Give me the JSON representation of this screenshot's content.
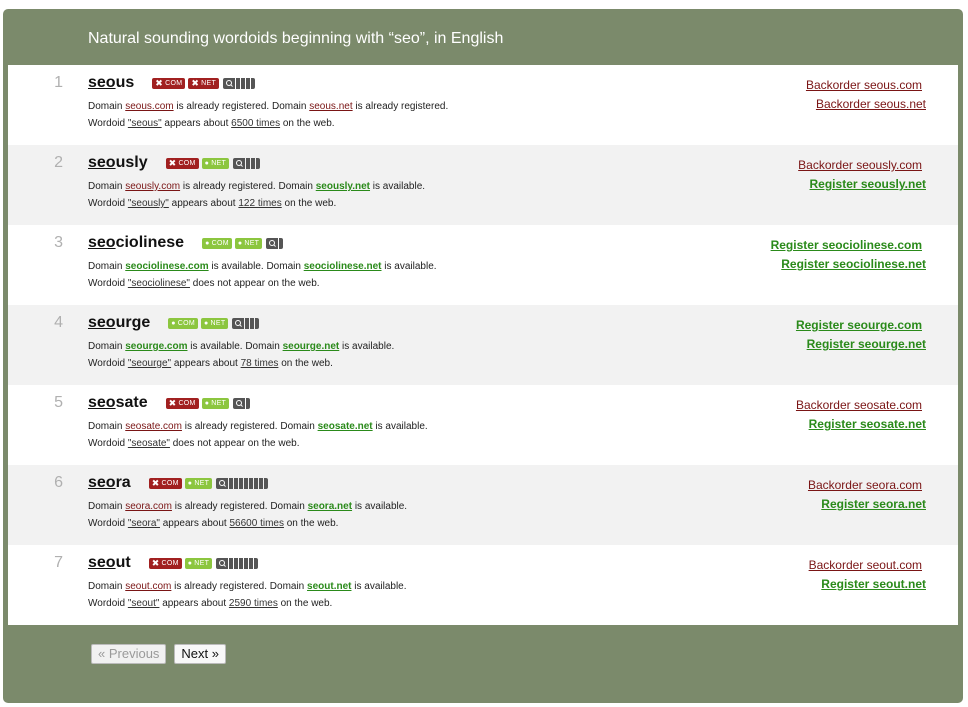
{
  "header": {
    "title": "Natural sounding wordoids beginning with “seo”, in English"
  },
  "results": [
    {
      "rank": "1",
      "prefix": "seo",
      "rest": "us",
      "com": {
        "status": "taken",
        "label": "COM",
        "domain": "seous.com",
        "text": "is already registered."
      },
      "net": {
        "status": "taken",
        "label": "NET",
        "domain": "seous.net",
        "text": "is already registered."
      },
      "meter_bars": 4,
      "freq_prefix": "Wordoid",
      "freq_word": "\"seous\"",
      "freq_before": "appears about",
      "freq_count": "6500 times",
      "freq_after": "on the web.",
      "action_com": "Backorder seous.com",
      "action_net": "Backorder seous.net"
    },
    {
      "rank": "2",
      "prefix": "seo",
      "rest": "usly",
      "com": {
        "status": "taken",
        "label": "COM",
        "domain": "seously.com",
        "text": "is already registered."
      },
      "net": {
        "status": "free",
        "label": "NET",
        "domain": "seously.net",
        "text": "is available."
      },
      "meter_bars": 3,
      "freq_prefix": "Wordoid",
      "freq_word": "\"seously\"",
      "freq_before": "appears about",
      "freq_count": "122 times",
      "freq_after": "on the web.",
      "action_com": "Backorder seously.com",
      "action_net": "Register seously.net"
    },
    {
      "rank": "3",
      "prefix": "seo",
      "rest": "ciolinese",
      "com": {
        "status": "free",
        "label": "COM",
        "domain": "seociolinese.com",
        "text": "is available."
      },
      "net": {
        "status": "free",
        "label": "NET",
        "domain": "seociolinese.net",
        "text": "is available."
      },
      "meter_bars": 1,
      "freq_prefix": "Wordoid",
      "freq_word": "\"seociolinese\"",
      "freq_before": "does not appear on the web.",
      "freq_count": "",
      "freq_after": "",
      "action_com": "Register seociolinese.com",
      "action_net": "Register seociolinese.net"
    },
    {
      "rank": "4",
      "prefix": "seo",
      "rest": "urge",
      "com": {
        "status": "free",
        "label": "COM",
        "domain": "seourge.com",
        "text": "is available."
      },
      "net": {
        "status": "free",
        "label": "NET",
        "domain": "seourge.net",
        "text": "is available."
      },
      "meter_bars": 3,
      "freq_prefix": "Wordoid",
      "freq_word": "\"seourge\"",
      "freq_before": "appears about",
      "freq_count": "78 times",
      "freq_after": "on the web.",
      "action_com": "Register seourge.com",
      "action_net": "Register seourge.net"
    },
    {
      "rank": "5",
      "prefix": "seo",
      "rest": "sate",
      "com": {
        "status": "taken",
        "label": "COM",
        "domain": "seosate.com",
        "text": "is already registered."
      },
      "net": {
        "status": "free",
        "label": "NET",
        "domain": "seosate.net",
        "text": "is available."
      },
      "meter_bars": 1,
      "freq_prefix": "Wordoid",
      "freq_word": "\"seosate\"",
      "freq_before": "does not appear on the web.",
      "freq_count": "",
      "freq_after": "",
      "action_com": "Backorder seosate.com",
      "action_net": "Register seosate.net"
    },
    {
      "rank": "6",
      "prefix": "seo",
      "rest": "ra",
      "com": {
        "status": "taken",
        "label": "COM",
        "domain": "seora.com",
        "text": "is already registered."
      },
      "net": {
        "status": "free",
        "label": "NET",
        "domain": "seora.net",
        "text": "is available."
      },
      "meter_bars": 8,
      "freq_prefix": "Wordoid",
      "freq_word": "\"seora\"",
      "freq_before": "appears about",
      "freq_count": "56600 times",
      "freq_after": "on the web.",
      "action_com": "Backorder seora.com",
      "action_net": "Register seora.net"
    },
    {
      "rank": "7",
      "prefix": "seo",
      "rest": "ut",
      "com": {
        "status": "taken",
        "label": "COM",
        "domain": "seout.com",
        "text": "is already registered."
      },
      "net": {
        "status": "free",
        "label": "NET",
        "domain": "seout.net",
        "text": "is available."
      },
      "meter_bars": 6,
      "freq_prefix": "Wordoid",
      "freq_word": "\"seout\"",
      "freq_before": "appears about",
      "freq_count": "2590 times",
      "freq_after": "on the web.",
      "action_com": "Backorder seout.com",
      "action_net": "Register seout.net"
    }
  ],
  "labels": {
    "domain_word": "Domain",
    "taken_mark": "✖",
    "free_mark": "●"
  },
  "pager": {
    "previous": "« Previous",
    "next": "Next »"
  },
  "colors": {
    "frame": "#7b8a6b",
    "taken": "#a12020",
    "free": "#8cc63f",
    "backorder_link": "#7a1515",
    "register_link": "#2a8a1a"
  }
}
